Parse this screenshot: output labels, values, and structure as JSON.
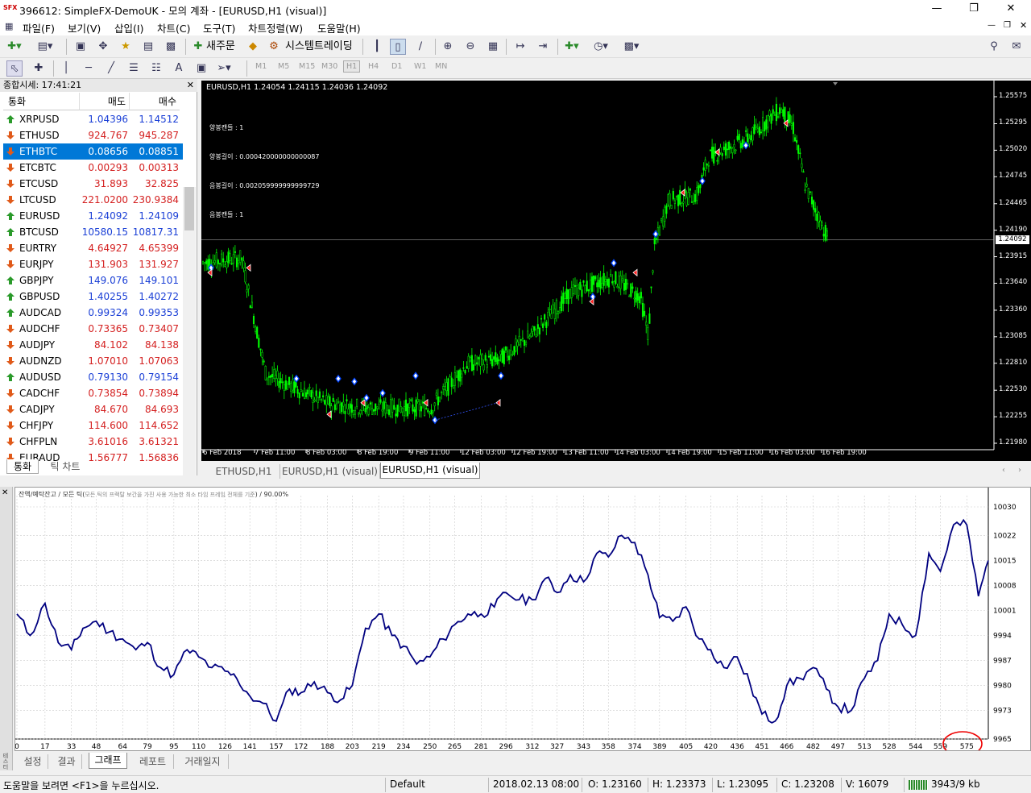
{
  "window": {
    "title": "396612: SimpleFX-DemoUK - 모의 계좌 - [EURUSD,H1 (visual)]",
    "logo": "SFX"
  },
  "menu": [
    "파일(F)",
    "보기(V)",
    "삽입(I)",
    "차트(C)",
    "도구(T)",
    "차트정렬(W)",
    "도움말(H)"
  ],
  "toolbar": {
    "new_order": "새주문",
    "system_trading": "시스템트레이딩"
  },
  "timeframes": [
    "M1",
    "M5",
    "M15",
    "M30",
    "H1",
    "H4",
    "D1",
    "W1",
    "MN"
  ],
  "market_watch": {
    "header": "종합시세: 17:41:21",
    "columns": [
      "통화",
      "매도",
      "매수"
    ],
    "rows": [
      {
        "symbol": "XRPUSD",
        "bid": "1.04396",
        "ask": "1.14512",
        "dir": "up",
        "color": "blue"
      },
      {
        "symbol": "ETHUSD",
        "bid": "924.767",
        "ask": "945.287",
        "dir": "down",
        "color": "red"
      },
      {
        "symbol": "ETHBTC",
        "bid": "0.08656",
        "ask": "0.08851",
        "dir": "down",
        "color": "sel"
      },
      {
        "symbol": "ETCBTC",
        "bid": "0.00293",
        "ask": "0.00313",
        "dir": "down",
        "color": "red"
      },
      {
        "symbol": "ETCUSD",
        "bid": "31.893",
        "ask": "32.825",
        "dir": "down",
        "color": "red"
      },
      {
        "symbol": "LTCUSD",
        "bid": "221.0200",
        "ask": "230.9384",
        "dir": "down",
        "color": "red"
      },
      {
        "symbol": "EURUSD",
        "bid": "1.24092",
        "ask": "1.24109",
        "dir": "up",
        "color": "blue"
      },
      {
        "symbol": "BTCUSD",
        "bid": "10580.15",
        "ask": "10817.31",
        "dir": "up",
        "color": "blue"
      },
      {
        "symbol": "EURTRY",
        "bid": "4.64927",
        "ask": "4.65399",
        "dir": "down",
        "color": "red"
      },
      {
        "symbol": "EURJPY",
        "bid": "131.903",
        "ask": "131.927",
        "dir": "down",
        "color": "red"
      },
      {
        "symbol": "GBPJPY",
        "bid": "149.076",
        "ask": "149.101",
        "dir": "up",
        "color": "blue"
      },
      {
        "symbol": "GBPUSD",
        "bid": "1.40255",
        "ask": "1.40272",
        "dir": "up",
        "color": "blue"
      },
      {
        "symbol": "AUDCAD",
        "bid": "0.99324",
        "ask": "0.99353",
        "dir": "up",
        "color": "blue"
      },
      {
        "symbol": "AUDCHF",
        "bid": "0.73365",
        "ask": "0.73407",
        "dir": "down",
        "color": "red"
      },
      {
        "symbol": "AUDJPY",
        "bid": "84.102",
        "ask": "84.138",
        "dir": "down",
        "color": "red"
      },
      {
        "symbol": "AUDNZD",
        "bid": "1.07010",
        "ask": "1.07063",
        "dir": "down",
        "color": "red"
      },
      {
        "symbol": "AUDUSD",
        "bid": "0.79130",
        "ask": "0.79154",
        "dir": "up",
        "color": "blue"
      },
      {
        "symbol": "CADCHF",
        "bid": "0.73854",
        "ask": "0.73894",
        "dir": "down",
        "color": "red"
      },
      {
        "symbol": "CADJPY",
        "bid": "84.670",
        "ask": "84.693",
        "dir": "down",
        "color": "red"
      },
      {
        "symbol": "CHFJPY",
        "bid": "114.600",
        "ask": "114.652",
        "dir": "down",
        "color": "red"
      },
      {
        "symbol": "CHFPLN",
        "bid": "3.61016",
        "ask": "3.61321",
        "dir": "down",
        "color": "red"
      },
      {
        "symbol": "EURAUD",
        "bid": "1.56777",
        "ask": "1.56836",
        "dir": "down",
        "color": "red"
      }
    ],
    "tabs": [
      "통화",
      "틱 차트"
    ]
  },
  "chart": {
    "info": "EURUSD,H1  1.24054 1.24115 1.24036 1.24092",
    "overlay": [
      "양봉캔들 : 1",
      "양봉길이 : 0.000420000000000087",
      "음봉길이 : 0.002059999999999729",
      "음봉캔들 : 1"
    ],
    "price_labels": [
      "1.25575",
      "1.25295",
      "1.25020",
      "1.24745",
      "1.24465",
      "1.24190",
      "1.23915",
      "1.23640",
      "1.23360",
      "1.23085",
      "1.22810",
      "1.22530",
      "1.22255",
      "1.21980"
    ],
    "current_price": "1.24092",
    "time_labels": [
      "6 Feb 2018",
      "7 Feb 11:00",
      "8 Feb 03:00",
      "8 Feb 19:00",
      "9 Feb 11:00",
      "12 Feb 03:00",
      "12 Feb 19:00",
      "13 Feb 11:00",
      "14 Feb 03:00",
      "14 Feb 19:00",
      "15 Feb 11:00",
      "16 Feb 03:00",
      "16 Feb 19:00"
    ],
    "candle_color": "#00ff00",
    "background": "#000000"
  },
  "chart_tabs": [
    "ETHUSD,H1",
    "EURUSD,H1 (visual)",
    "EURUSD,H1 (visual)"
  ],
  "tester": {
    "caption_prefix": "잔액/예탁잔고 / 모든 틱(",
    "caption_mid": "모든 틱의 프랙탈 보간을 가진 사용 가능한 최소 타임 프레임 전체를 기준",
    "caption_suffix": ") / 90.00%",
    "side_label": "테스터",
    "tabs": [
      "설정",
      "결과",
      "그래프",
      "레포트",
      "거래일지"
    ]
  },
  "chart_data": {
    "type": "line",
    "x_ticks": [
      "0",
      "17",
      "33",
      "48",
      "64",
      "79",
      "95",
      "110",
      "126",
      "141",
      "157",
      "172",
      "188",
      "203",
      "219",
      "234",
      "250",
      "265",
      "281",
      "296",
      "312",
      "327",
      "343",
      "358",
      "374",
      "389",
      "405",
      "420",
      "436",
      "451",
      "466",
      "482",
      "497",
      "513",
      "528",
      "544",
      "559",
      "575"
    ],
    "y_ticks": [
      "10030",
      "10022",
      "10015",
      "10008",
      "10001",
      "9994",
      "9987",
      "9980",
      "9973",
      "9965"
    ],
    "ylim": [
      9965,
      10030
    ],
    "series": [
      {
        "color": "#000080",
        "x": [
          0,
          8,
          17,
          25,
          33,
          40,
          48,
          56,
          64,
          72,
          79,
          87,
          95,
          103,
          110,
          118,
          126,
          133,
          141,
          149,
          157,
          165,
          172,
          180,
          188,
          196,
          203,
          211,
          219,
          227,
          234,
          242,
          250,
          258,
          265,
          273,
          281,
          289,
          296,
          304,
          312,
          320,
          327,
          335,
          343,
          351,
          358,
          366,
          374,
          382,
          389,
          397,
          405,
          413,
          420,
          428,
          436,
          444,
          451,
          459,
          466,
          474,
          482,
          490,
          497,
          505,
          513,
          521,
          528,
          536,
          544,
          552,
          559,
          567,
          575,
          582,
          588
        ],
        "values": [
          10000,
          9994,
          10003,
          9992,
          9990,
          9996,
          9998,
          9995,
          9993,
          9990,
          9992,
          9985,
          9983,
          9990,
          9988,
          9985,
          9984,
          9982,
          9977,
          9975,
          9970,
          9979,
          9978,
          9981,
          9978,
          9976,
          9980,
          9996,
          10000,
          9994,
          9991,
          9986,
          9988,
          9993,
          9997,
          10000,
          10000,
          10002,
          10006,
          10004,
          10004,
          10010,
          10006,
          10011,
          10009,
          10017,
          10016,
          10022,
          10020,
          10011,
          9999,
          9998,
          10002,
          9993,
          9990,
          9985,
          9988,
          9980,
          9972,
          9970,
          9980,
          9982,
          9985,
          9979,
          9974,
          9973,
          9982,
          9987,
          10000,
          9997,
          9994,
          10017,
          10012,
          10025,
          10025,
          10005,
          10015
        ]
      }
    ]
  }
}
